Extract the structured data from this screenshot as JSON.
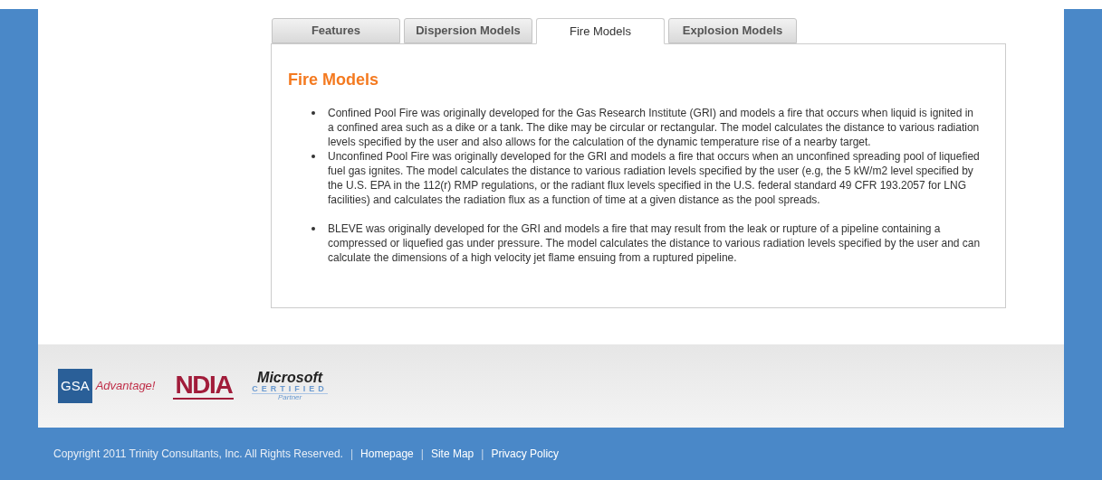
{
  "tabs": [
    {
      "label": "Features",
      "selected": false
    },
    {
      "label": "Dispersion Models",
      "selected": false
    },
    {
      "label": "Fire Models",
      "selected": true
    },
    {
      "label": "Explosion Models",
      "selected": false
    }
  ],
  "panel": {
    "heading": "Fire Models",
    "items": [
      {
        "text": "Confined Pool Fire was originally developed for the Gas Research Institute (GRI) and models a fire that occurs when liquid is ignited in a confined area such as a dike or a tank. The dike may be circular or rectangular. The model calculates the distance to various radiation levels specified by the user and also allows for the calculation of the dynamic temperature rise of a nearby target."
      },
      {
        "text": "Unconfined Pool Fire was originally developed for the GRI and models a fire that occurs when an unconfined spreading pool of liquefied fuel gas ignites. The model calculates the distance to various radiation levels specified by the user (e.g, the 5 kW/m2 level specified by the U.S. EPA in the 112(r) RMP regulations, or the radiant flux levels specified in the U.S. federal standard 49 CFR 193.2057 for LNG facilities) and calculates the radiation flux as a function of time at a given distance as the pool spreads."
      },
      {
        "text": "BLEVE was originally developed for the GRI and models a fire that may result from the leak or rupture of a pipeline containing a compressed or liquefied gas under pressure. The model calculates the distance to various radiation levels specified by the user and can calculate the dimensions of a high velocity jet flame ensuing from a ruptured pipeline."
      }
    ]
  },
  "logos": {
    "gsa": {
      "mark": "GSA",
      "name": "Advantage!"
    },
    "ndia": {
      "name": "NDIA"
    },
    "microsoft": {
      "name": "Microsoft",
      "badge": "CERTIFIED",
      "tier": "Partner"
    }
  },
  "footer": {
    "copyright": "Copyright 2011 Trinity Consultants, Inc. All Rights Reserved.",
    "links": [
      {
        "separator": "|",
        "label": "Homepage"
      },
      {
        "separator": "|",
        "label": "Site Map"
      },
      {
        "separator": "|",
        "label": "Privacy Policy"
      }
    ]
  }
}
